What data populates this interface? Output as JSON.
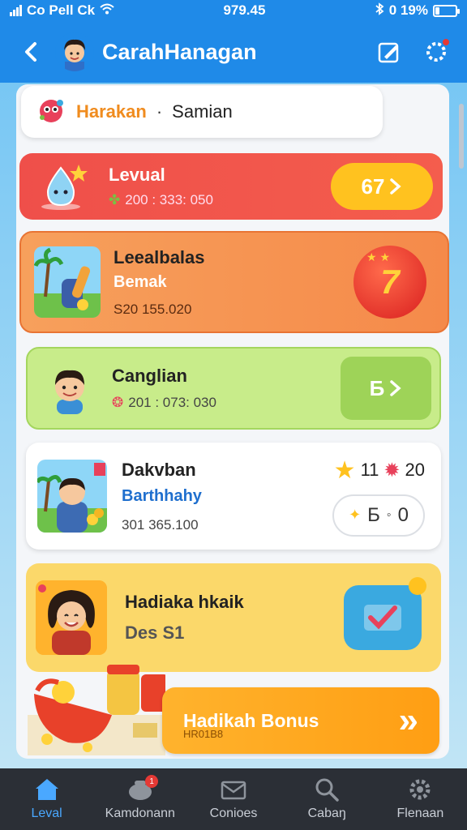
{
  "status_bar": {
    "carrier": "Co Pell Ck",
    "time": "979.45",
    "battery": "0 19%",
    "battery_level": 0.19
  },
  "header": {
    "title": "CarahHanagan"
  },
  "search_card": {
    "label": "Harakan",
    "separator": "·",
    "name": "Samian"
  },
  "cards": [
    {
      "title": "Levual",
      "meta": "200 : 333: 050",
      "button": "67"
    },
    {
      "title": "Leealbalas",
      "subtitle": "Bemak",
      "meta": "S20 155.020",
      "badge": "7"
    },
    {
      "title": "Canglian",
      "meta": "201 : 073: 030",
      "button": "Б"
    },
    {
      "title": "Dakvban",
      "subtitle": "Barthhahy",
      "meta": "301 365.100",
      "stars": "11",
      "stars_right": "20",
      "pill": "Б",
      "pill_right": "0"
    },
    {
      "title": "Hadiaka hkaik",
      "subtitle": "Des S1"
    }
  ],
  "bonus": {
    "label": "Hadikah Bonus",
    "sublabel": "HR01B8",
    "arrows": "»"
  },
  "bottom_nav": [
    {
      "label": "Leval",
      "active": true
    },
    {
      "label": "Kamdonann",
      "badge": "1"
    },
    {
      "label": "Conioes"
    },
    {
      "label": "Cabaŋ"
    },
    {
      "label": "Flenaan"
    }
  ],
  "colors": {
    "primary": "#1f8ae8",
    "card_red": "#ef4f4a",
    "card_orange": "#f7a05c",
    "card_green": "#c8ec8a",
    "card_yellow": "#fbd86a",
    "accent_orange": "#ffb32d",
    "nav_bg": "#2b2f36",
    "nav_active": "#4aa8ff"
  }
}
